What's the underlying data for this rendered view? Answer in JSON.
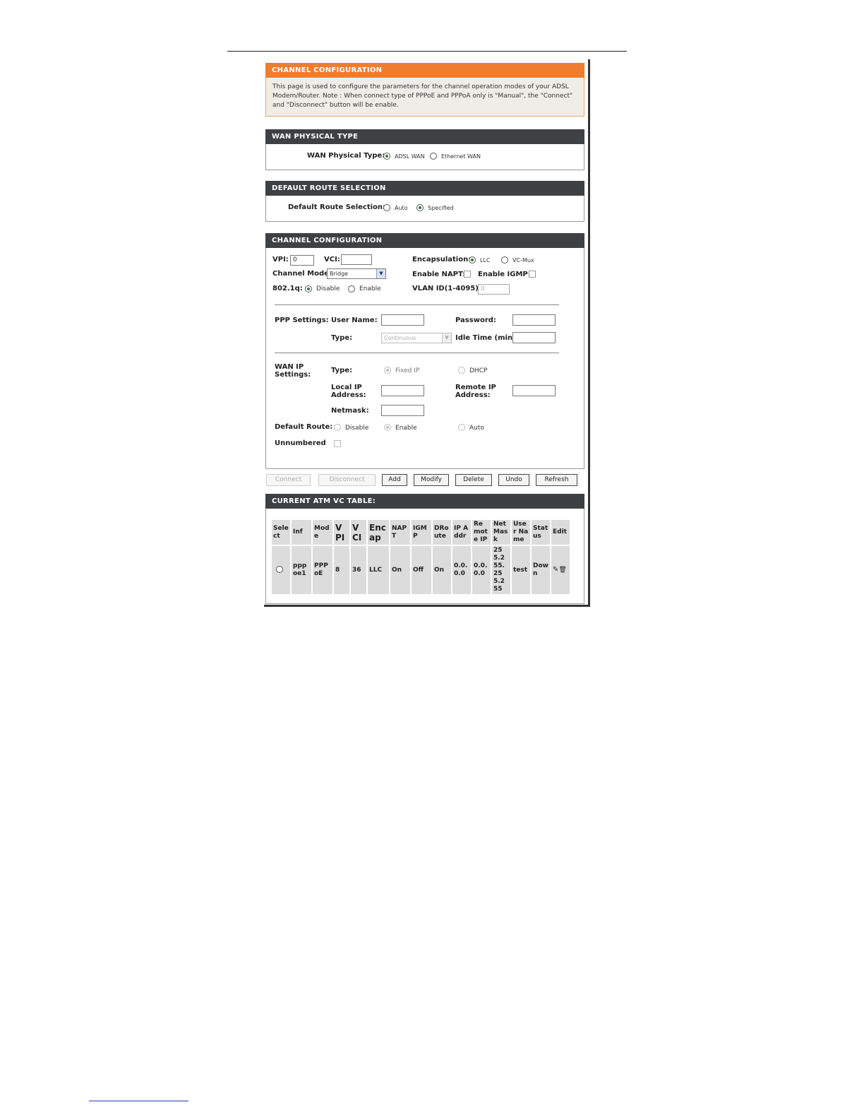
{
  "intro": {
    "title": "CHANNEL CONFIGURATION",
    "text": "This page is used to configure the parameters for the channel operation modes of your ADSL Modem/Router. Note : When connect type of PPPoE and PPPoA only is \"Manual\", the \"Connect\" and \"Disconnect\" button will be enable."
  },
  "wan_physical": {
    "title": "WAN PHYSICAL TYPE",
    "label": "WAN Physical Type:",
    "options": [
      "ADSL WAN",
      "Ethernet WAN"
    ],
    "selected": "ADSL WAN"
  },
  "default_route": {
    "title": "DEFAULT ROUTE SELECTION",
    "label": "Default Route Selection:",
    "options": [
      "Auto",
      "Specified"
    ],
    "selected": "Specified"
  },
  "channel": {
    "title": "CHANNEL CONFIGURATION",
    "vpi_label": "VPI:",
    "vpi_value": "0",
    "vci_label": "VCI:",
    "vci_value": "",
    "encap_label": "Encapsulation:",
    "encap_options": [
      "LLC",
      "VC-Mux"
    ],
    "mode_label": "Channel Mode:",
    "mode_value": "Bridge",
    "napt_label": "Enable NAPT:",
    "igmp_label": "Enable IGMP:",
    "dot1q_label": "802.1q:",
    "dot1q_options": [
      "Disable",
      "Enable"
    ],
    "vlan_label": "VLAN ID(1-4095):",
    "vlan_value": "0"
  },
  "ppp": {
    "label": "PPP Settings:",
    "user_label": "User Name:",
    "password_label": "Password:",
    "type_label": "Type:",
    "type_value": "Continuous",
    "idle_label": "Idle Time (min):"
  },
  "wan_ip": {
    "label": "WAN IP Settings:",
    "type_label": "Type:",
    "type_options": [
      "Fixed IP",
      "DHCP"
    ],
    "local_label": "Local IP Address:",
    "remote_label": "Remote IP Address:",
    "netmask_label": "Netmask:",
    "default_route_label": "Default Route:",
    "default_route_options": [
      "Disable",
      "Enable",
      "Auto"
    ],
    "unnumbered_label": "Unnumbered"
  },
  "buttons": {
    "connect": "Connect",
    "disconnect": "Disconnect",
    "add": "Add",
    "modify": "Modify",
    "delete": "Delete",
    "undo": "Undo",
    "refresh": "Refresh"
  },
  "vc_table": {
    "title": "CURRENT ATM VC TABLE:",
    "headers": [
      "Select",
      "Inf",
      "Mode",
      "VPI",
      "VCI",
      "Encap",
      "NAPT",
      "IGMP",
      "DRoute",
      "IP Addr",
      "Remote IP",
      "NetMask",
      "User Name",
      "Status",
      "Edit"
    ],
    "row": [
      "",
      "pppoe1",
      "PPPoE",
      "8",
      "36",
      "LLC",
      "On",
      "Off",
      "On",
      "0.0.0.0",
      "0.0.0.0",
      "255.255.255.255",
      "test",
      "Down",
      ""
    ]
  },
  "icons": {
    "edit": "pencil-icon",
    "delete": "trash-icon"
  }
}
